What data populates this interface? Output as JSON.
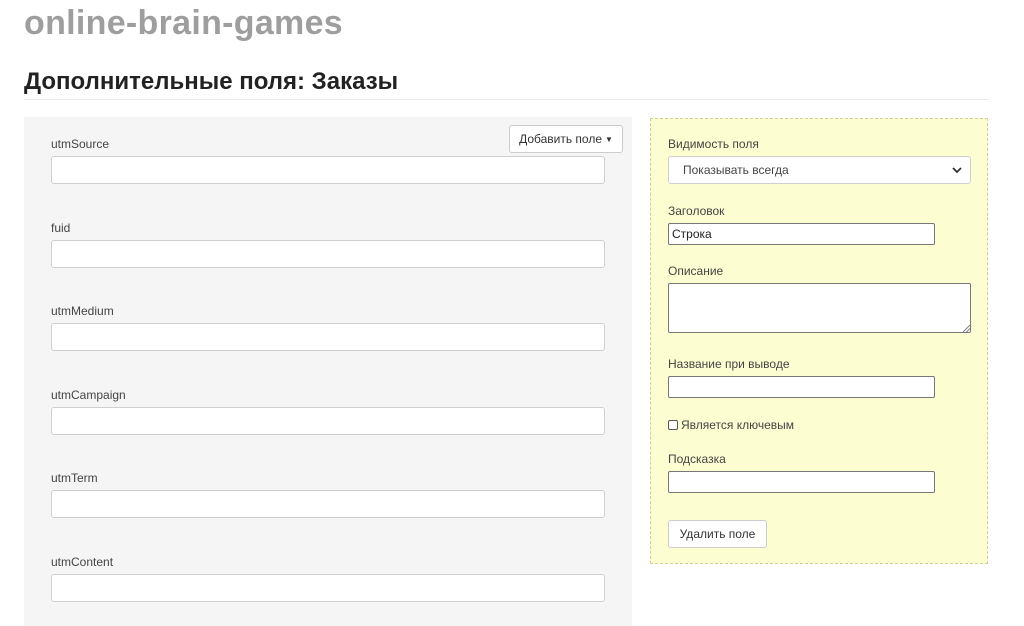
{
  "site": {
    "title": "online-brain-games"
  },
  "page": {
    "title": "Дополнительные поля: Заказы"
  },
  "left_panel": {
    "add_field_button": "Добавить поле",
    "fields": [
      {
        "label": "utmSource",
        "value": ""
      },
      {
        "label": "fuid",
        "value": ""
      },
      {
        "label": "utmMedium",
        "value": ""
      },
      {
        "label": "utmCampaign",
        "value": ""
      },
      {
        "label": "utmTerm",
        "value": ""
      },
      {
        "label": "utmContent",
        "value": ""
      }
    ]
  },
  "right_panel": {
    "visibility_label": "Видимость поля",
    "visibility_value": "Показывать всегда",
    "heading_label": "Заголовок",
    "heading_value": "Строка",
    "description_label": "Описание",
    "description_value": "",
    "output_name_label": "Название при выводе",
    "output_name_value": "",
    "is_key_label": "Является ключевым",
    "is_key_checked": false,
    "hint_label": "Подсказка",
    "hint_value": "",
    "delete_button": "Удалить поле"
  },
  "colors": {
    "site_title": "#9e9e9e",
    "left_panel_bg": "#f5f5f5",
    "right_panel_bg": "#fdfdd2"
  },
  "icons": [
    "chevron-down-icon",
    "caret-down-icon",
    "resize-grip-icon",
    "checkbox-icon"
  ]
}
